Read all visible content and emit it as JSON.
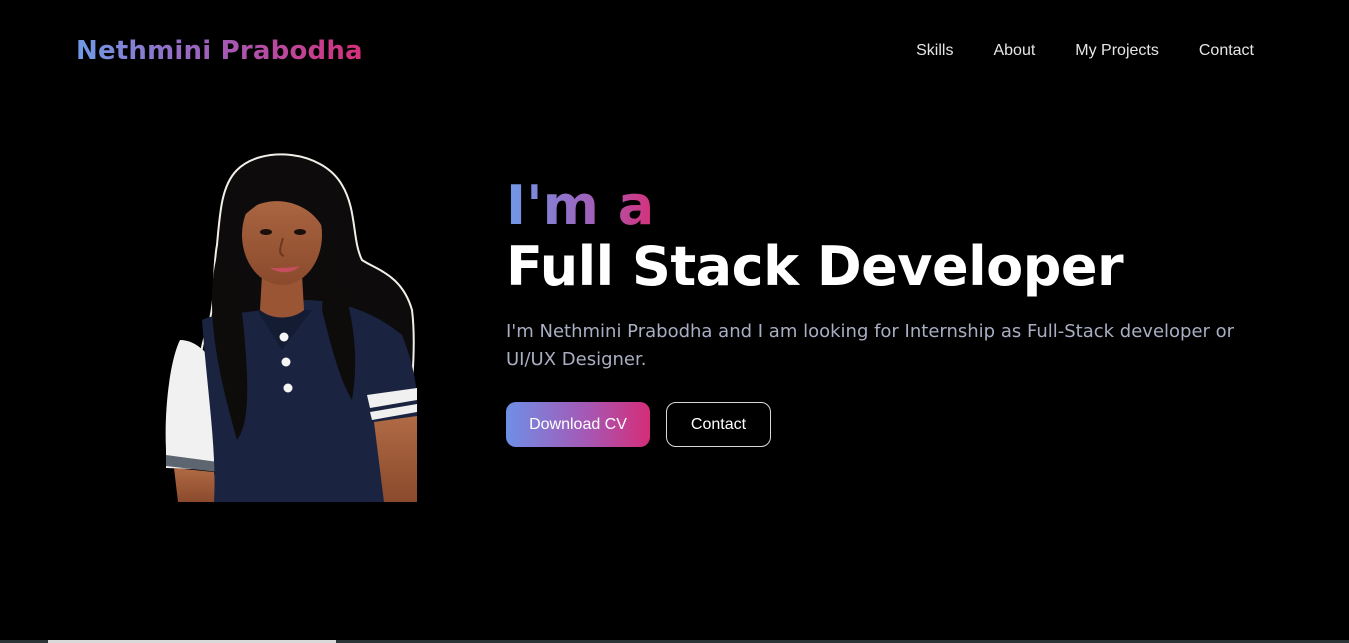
{
  "header": {
    "brand": "Nethmini Prabodha",
    "nav": [
      "Skills",
      "About",
      "My Projects",
      "Contact"
    ]
  },
  "hero": {
    "intro": "I'm a",
    "role": "Full Stack Developer",
    "description": "I'm Nethmini Prabodha and I am looking for Internship as Full-Stack developer or UI/UX Designer.",
    "primary_button": "Download CV",
    "secondary_button": "Contact"
  },
  "colors": {
    "background": "#000000",
    "gradient_start": "#6f9ae8",
    "gradient_mid": "#a45bb6",
    "gradient_end": "#d6307a",
    "description_text": "#a9aec2"
  }
}
